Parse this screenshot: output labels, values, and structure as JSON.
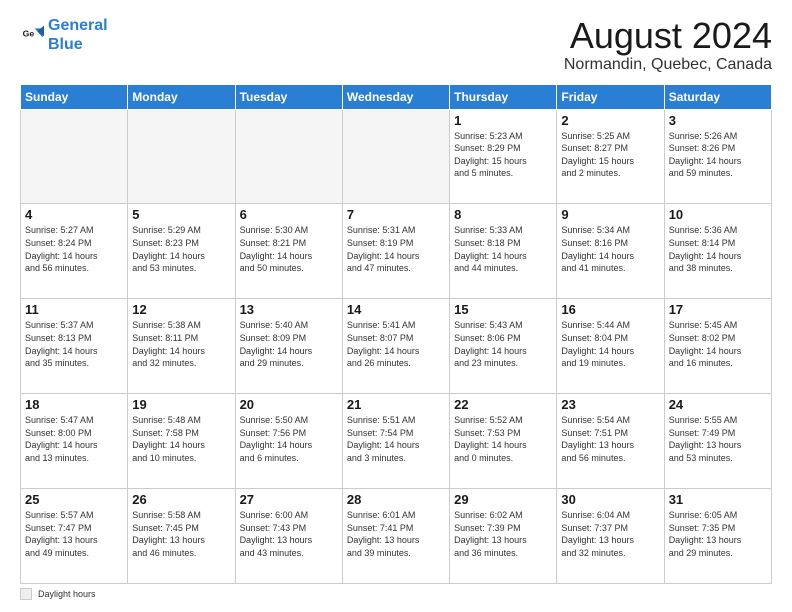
{
  "logo": {
    "line1": "General",
    "line2": "Blue"
  },
  "header": {
    "month_year": "August 2024",
    "location": "Normandin, Quebec, Canada"
  },
  "days_of_week": [
    "Sunday",
    "Monday",
    "Tuesday",
    "Wednesday",
    "Thursday",
    "Friday",
    "Saturday"
  ],
  "weeks": [
    [
      {
        "day": "",
        "info": ""
      },
      {
        "day": "",
        "info": ""
      },
      {
        "day": "",
        "info": ""
      },
      {
        "day": "",
        "info": ""
      },
      {
        "day": "1",
        "info": "Sunrise: 5:23 AM\nSunset: 8:29 PM\nDaylight: 15 hours\nand 5 minutes."
      },
      {
        "day": "2",
        "info": "Sunrise: 5:25 AM\nSunset: 8:27 PM\nDaylight: 15 hours\nand 2 minutes."
      },
      {
        "day": "3",
        "info": "Sunrise: 5:26 AM\nSunset: 8:26 PM\nDaylight: 14 hours\nand 59 minutes."
      }
    ],
    [
      {
        "day": "4",
        "info": "Sunrise: 5:27 AM\nSunset: 8:24 PM\nDaylight: 14 hours\nand 56 minutes."
      },
      {
        "day": "5",
        "info": "Sunrise: 5:29 AM\nSunset: 8:23 PM\nDaylight: 14 hours\nand 53 minutes."
      },
      {
        "day": "6",
        "info": "Sunrise: 5:30 AM\nSunset: 8:21 PM\nDaylight: 14 hours\nand 50 minutes."
      },
      {
        "day": "7",
        "info": "Sunrise: 5:31 AM\nSunset: 8:19 PM\nDaylight: 14 hours\nand 47 minutes."
      },
      {
        "day": "8",
        "info": "Sunrise: 5:33 AM\nSunset: 8:18 PM\nDaylight: 14 hours\nand 44 minutes."
      },
      {
        "day": "9",
        "info": "Sunrise: 5:34 AM\nSunset: 8:16 PM\nDaylight: 14 hours\nand 41 minutes."
      },
      {
        "day": "10",
        "info": "Sunrise: 5:36 AM\nSunset: 8:14 PM\nDaylight: 14 hours\nand 38 minutes."
      }
    ],
    [
      {
        "day": "11",
        "info": "Sunrise: 5:37 AM\nSunset: 8:13 PM\nDaylight: 14 hours\nand 35 minutes."
      },
      {
        "day": "12",
        "info": "Sunrise: 5:38 AM\nSunset: 8:11 PM\nDaylight: 14 hours\nand 32 minutes."
      },
      {
        "day": "13",
        "info": "Sunrise: 5:40 AM\nSunset: 8:09 PM\nDaylight: 14 hours\nand 29 minutes."
      },
      {
        "day": "14",
        "info": "Sunrise: 5:41 AM\nSunset: 8:07 PM\nDaylight: 14 hours\nand 26 minutes."
      },
      {
        "day": "15",
        "info": "Sunrise: 5:43 AM\nSunset: 8:06 PM\nDaylight: 14 hours\nand 23 minutes."
      },
      {
        "day": "16",
        "info": "Sunrise: 5:44 AM\nSunset: 8:04 PM\nDaylight: 14 hours\nand 19 minutes."
      },
      {
        "day": "17",
        "info": "Sunrise: 5:45 AM\nSunset: 8:02 PM\nDaylight: 14 hours\nand 16 minutes."
      }
    ],
    [
      {
        "day": "18",
        "info": "Sunrise: 5:47 AM\nSunset: 8:00 PM\nDaylight: 14 hours\nand 13 minutes."
      },
      {
        "day": "19",
        "info": "Sunrise: 5:48 AM\nSunset: 7:58 PM\nDaylight: 14 hours\nand 10 minutes."
      },
      {
        "day": "20",
        "info": "Sunrise: 5:50 AM\nSunset: 7:56 PM\nDaylight: 14 hours\nand 6 minutes."
      },
      {
        "day": "21",
        "info": "Sunrise: 5:51 AM\nSunset: 7:54 PM\nDaylight: 14 hours\nand 3 minutes."
      },
      {
        "day": "22",
        "info": "Sunrise: 5:52 AM\nSunset: 7:53 PM\nDaylight: 14 hours\nand 0 minutes."
      },
      {
        "day": "23",
        "info": "Sunrise: 5:54 AM\nSunset: 7:51 PM\nDaylight: 13 hours\nand 56 minutes."
      },
      {
        "day": "24",
        "info": "Sunrise: 5:55 AM\nSunset: 7:49 PM\nDaylight: 13 hours\nand 53 minutes."
      }
    ],
    [
      {
        "day": "25",
        "info": "Sunrise: 5:57 AM\nSunset: 7:47 PM\nDaylight: 13 hours\nand 49 minutes."
      },
      {
        "day": "26",
        "info": "Sunrise: 5:58 AM\nSunset: 7:45 PM\nDaylight: 13 hours\nand 46 minutes."
      },
      {
        "day": "27",
        "info": "Sunrise: 6:00 AM\nSunset: 7:43 PM\nDaylight: 13 hours\nand 43 minutes."
      },
      {
        "day": "28",
        "info": "Sunrise: 6:01 AM\nSunset: 7:41 PM\nDaylight: 13 hours\nand 39 minutes."
      },
      {
        "day": "29",
        "info": "Sunrise: 6:02 AM\nSunset: 7:39 PM\nDaylight: 13 hours\nand 36 minutes."
      },
      {
        "day": "30",
        "info": "Sunrise: 6:04 AM\nSunset: 7:37 PM\nDaylight: 13 hours\nand 32 minutes."
      },
      {
        "day": "31",
        "info": "Sunrise: 6:05 AM\nSunset: 7:35 PM\nDaylight: 13 hours\nand 29 minutes."
      }
    ]
  ],
  "footer": {
    "label": "Daylight hours"
  }
}
